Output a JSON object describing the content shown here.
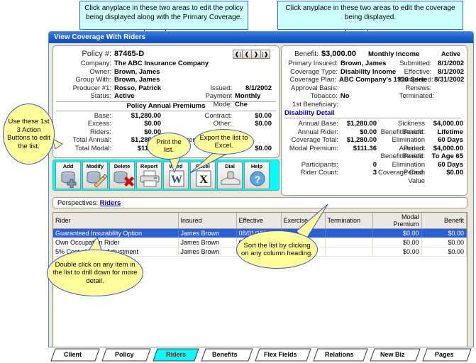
{
  "annotations": {
    "policy_note": "Click anyplace in these two areas to edit the policy being displayed along with the Primary Coverage.",
    "coverage_note": "Click anyplace in these two areas to edit the coverage being displayed.",
    "action_buttons_note": "Use these 1st 3 Action Buttons to edit the list.",
    "print_note": "Print the list.",
    "excel_note": "Export the list to Excel.",
    "sort_note": "Sort the list by clicking on any column heading.",
    "drill_note": "Double click on any item in the list to drill down for more detail."
  },
  "window": {
    "title": "View Coverage With Riders"
  },
  "nav_buttons": [
    {
      "name": "first-record",
      "glyph": "❘◄"
    },
    {
      "name": "previous-record",
      "glyph": "◄"
    },
    {
      "name": "next-record",
      "glyph": "►"
    },
    {
      "name": "last-record",
      "glyph": "►❘"
    }
  ],
  "policy_panel": {
    "fields": [
      {
        "label": "Policy #:",
        "value": "87465-D",
        "big": true
      },
      {
        "label": "Company:",
        "value": "The ABC Insurance Company"
      },
      {
        "label": "Owner:",
        "value": "Brown, James"
      },
      {
        "label": "Group With:",
        "value": "Brown, James"
      },
      {
        "label": "Producer #1:",
        "value": "Rosso, Patrick"
      },
      {
        "label": "Status:",
        "value": "Active"
      }
    ],
    "right_fields": [
      {
        "label": "Issued:",
        "value": "8/1/2002"
      },
      {
        "label": "Payment Mode:",
        "value": "Monthly Che"
      }
    ],
    "premiums_header": "Policy Annual Premiums",
    "premiums_left": [
      {
        "label": "Base:",
        "value": "$1,280.00"
      },
      {
        "label": "Excess:",
        "value": "$0.00"
      },
      {
        "label": "Riders:",
        "value": "$0.00"
      },
      {
        "label": "Total Annual:",
        "value": "$1,280.00"
      },
      {
        "label": "Total Modal:",
        "value": "$111.36"
      }
    ],
    "premiums_right": [
      {
        "label": "Contract:",
        "value": "$0.00"
      },
      {
        "label": "Other:",
        "value": "$0.00"
      },
      {
        "label": "Loan:",
        "value": ""
      },
      {
        "label": "Surrender Charge:",
        "value": ""
      },
      {
        "label": "Net Value:",
        "value": "$0.00"
      }
    ]
  },
  "coverage_panel": {
    "benefit_label": "Benefit:",
    "benefit_value": "$3,000.00",
    "benefit_type": "Monthly Income",
    "status": "Active",
    "fields": [
      {
        "label": "Primary Insured:",
        "value": "Brown, James"
      },
      {
        "label": "Coverage Type:",
        "value": "Disability Income"
      },
      {
        "label": "Coverage Plan:",
        "value": "ABC  Company's  1990 Serie"
      },
      {
        "label": "Approval Basis:",
        "value": ""
      },
      {
        "label": "Tobacco:",
        "value": "No"
      },
      {
        "label": "1st Beneficiary:",
        "value": ""
      }
    ],
    "right_fields": [
      {
        "label": "Submitted:",
        "value": "8/1/2002"
      },
      {
        "label": "Effective:",
        "value": "8/1/2002"
      },
      {
        "label": "Completed:",
        "value": "8/31/2002"
      },
      {
        "label": "Renews:",
        "value": ""
      },
      {
        "label": "Terminated:",
        "value": ""
      }
    ],
    "detail_header": "Disability Detail",
    "detail_left": [
      {
        "label": "Annual Base:",
        "value": "$1,280.00"
      },
      {
        "label": "Annual Rider:",
        "value": "$0.00"
      },
      {
        "label": "Coverage Total:",
        "value": "$1,280.00"
      },
      {
        "label": "Modal Premium:",
        "value": "$111.36"
      },
      {
        "label": "",
        "value": ""
      },
      {
        "label": "Participants:",
        "value": "0"
      },
      {
        "label": "Rider Count:",
        "value": "3"
      }
    ],
    "detail_right": [
      {
        "label": "Sickness Benefit:",
        "value": "$4,000.00"
      },
      {
        "label": "Benefit Period:",
        "value": "Lifetime"
      },
      {
        "label": "Elimination Period:",
        "value": "60 Days"
      },
      {
        "label": "Accident Benefit:",
        "value": "$4,000.00"
      },
      {
        "label": "Benefit Period:",
        "value": "To Age 65"
      },
      {
        "label": "Elimination Period:",
        "value": "60 Days"
      },
      {
        "label": "Coverage Cash Value",
        "value": "$0.00"
      }
    ]
  },
  "toolbar": {
    "buttons": [
      {
        "label": "Add",
        "icon": "add-icon"
      },
      {
        "label": "Modify",
        "icon": "modify-icon"
      },
      {
        "label": "Delete",
        "icon": "delete-icon"
      },
      {
        "label": "Report",
        "icon": "printer-icon"
      },
      {
        "label": "Word",
        "icon": "word-icon"
      },
      {
        "label": "Excel",
        "icon": "excel-icon"
      },
      {
        "label": "Dial",
        "icon": "dial-icon"
      },
      {
        "label": "Help",
        "icon": "help-icon"
      }
    ]
  },
  "perspectives": {
    "label": "Perspectives:",
    "current": "Riders"
  },
  "grid": {
    "columns": [
      "Rider",
      "Insured",
      "Effective",
      "Exercise",
      "Termination",
      "Modal Premium",
      "Benefit"
    ],
    "rows": [
      {
        "rider": "Guaranteed Insurability Option",
        "insured": "James Brown",
        "effective": "08/01/1994",
        "exercise": "",
        "termination": "",
        "modal_premium": "$0.00",
        "benefit": "$0.00",
        "selected": true
      },
      {
        "rider": "Own Occupation Rider",
        "insured": "James Brown",
        "effective": "08/01/1994",
        "exercise": "",
        "termination": "",
        "modal_premium": "$0.00",
        "benefit": "$0.00",
        "selected": false
      },
      {
        "rider": "5% Cost of Living Adjustment",
        "insured": "James Brown",
        "effective": "08/01/1994",
        "exercise": "",
        "termination": "",
        "modal_premium": "$0.00",
        "benefit": "$0.00",
        "selected": false
      }
    ]
  },
  "tabs": [
    {
      "label": "Client",
      "active": false
    },
    {
      "label": "Policy",
      "active": false
    },
    {
      "label": "Riders",
      "active": true
    },
    {
      "label": "Benefits",
      "active": false
    },
    {
      "label": "Flex Fields",
      "active": false
    },
    {
      "label": "Relations",
      "active": false
    },
    {
      "label": "New Biz",
      "active": false
    },
    {
      "label": "Pages",
      "active": false
    }
  ],
  "colors": {
    "title_bar": "#1a5fd0",
    "toolbar_highlight": "#00ffff",
    "callout_fill": "#ccffff",
    "bubble_fill": "#ffff99",
    "selection": "#2b5fd9",
    "link": "#0000cc"
  }
}
